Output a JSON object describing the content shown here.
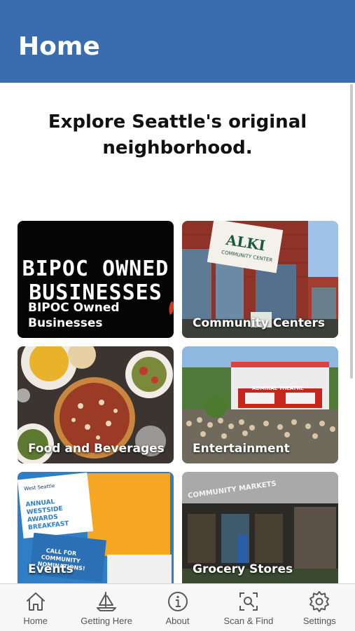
{
  "header": {
    "title": "Home"
  },
  "tagline": "Explore Seattle's original neighborhood.",
  "tiles": [
    {
      "label": "BIPOC Owned Businesses",
      "art_text_line1": "BIPOC OWNED",
      "art_text_line2": "BUSINESSES"
    },
    {
      "label": "Community Centers",
      "sign_text": "ALKI",
      "sign_subtext": "COMMUNITY CENTER"
    },
    {
      "label": "Food and Beverages"
    },
    {
      "label": "Entertainment",
      "marquee_text": "ADMIRAL THEATRE"
    },
    {
      "label": "Events",
      "flyer_title": "ANNUAL WESTSIDE AWARDS BREAKFAST",
      "flyer_call": "CALL FOR COMMUNITY NOMINATIONS!",
      "flyer_org": "West Seattle"
    },
    {
      "label": "Grocery Stores",
      "store_sign": "COMMUNITY MARKETS"
    }
  ],
  "tabbar": [
    {
      "label": "Home",
      "icon": "home-icon"
    },
    {
      "label": "Getting Here",
      "icon": "sailboat-icon"
    },
    {
      "label": "About",
      "icon": "info-icon"
    },
    {
      "label": "Scan & Find",
      "icon": "scan-icon"
    },
    {
      "label": "Settings",
      "icon": "gear-icon"
    }
  ],
  "colors": {
    "header": "#3a6cb0",
    "tab_label": "#555555",
    "tab_icon": "#5a5a5a"
  }
}
